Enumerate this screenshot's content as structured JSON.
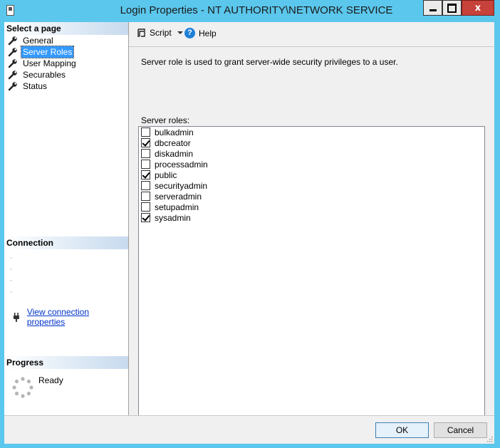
{
  "window": {
    "title": "Login Properties - NT AUTHORITY\\NETWORK SERVICE",
    "controls": {
      "minimize": "minimize",
      "maximize": "maximize",
      "close": "x"
    }
  },
  "sidebar": {
    "select_page_header": "Select a page",
    "items": [
      {
        "label": "General",
        "icon": "wrench-icon",
        "selected": false
      },
      {
        "label": "Server Roles",
        "icon": "wrench-icon",
        "selected": true
      },
      {
        "label": "User Mapping",
        "icon": "wrench-icon",
        "selected": false
      },
      {
        "label": "Securables",
        "icon": "wrench-icon",
        "selected": false
      },
      {
        "label": "Status",
        "icon": "wrench-icon",
        "selected": false
      }
    ],
    "connection_header": "Connection",
    "connection_link": "View connection properties",
    "progress_header": "Progress",
    "progress_status": "Ready"
  },
  "toolbar": {
    "script_label": "Script",
    "help_label": "Help"
  },
  "main": {
    "description": "Server role is used to grant server-wide security privileges to a user.",
    "roles_label": "Server roles:",
    "roles": [
      {
        "name": "bulkadmin",
        "checked": false
      },
      {
        "name": "dbcreator",
        "checked": true
      },
      {
        "name": "diskadmin",
        "checked": false
      },
      {
        "name": "processadmin",
        "checked": false
      },
      {
        "name": "public",
        "checked": true
      },
      {
        "name": "securityadmin",
        "checked": false
      },
      {
        "name": "serveradmin",
        "checked": false
      },
      {
        "name": "setupadmin",
        "checked": false
      },
      {
        "name": "sysadmin",
        "checked": true
      }
    ]
  },
  "footer": {
    "ok_label": "OK",
    "cancel_label": "Cancel"
  },
  "colors": {
    "window_frame": "#5bc7ec",
    "selection": "#3399ff",
    "link": "#0033cc",
    "close_button": "#c7423a"
  }
}
